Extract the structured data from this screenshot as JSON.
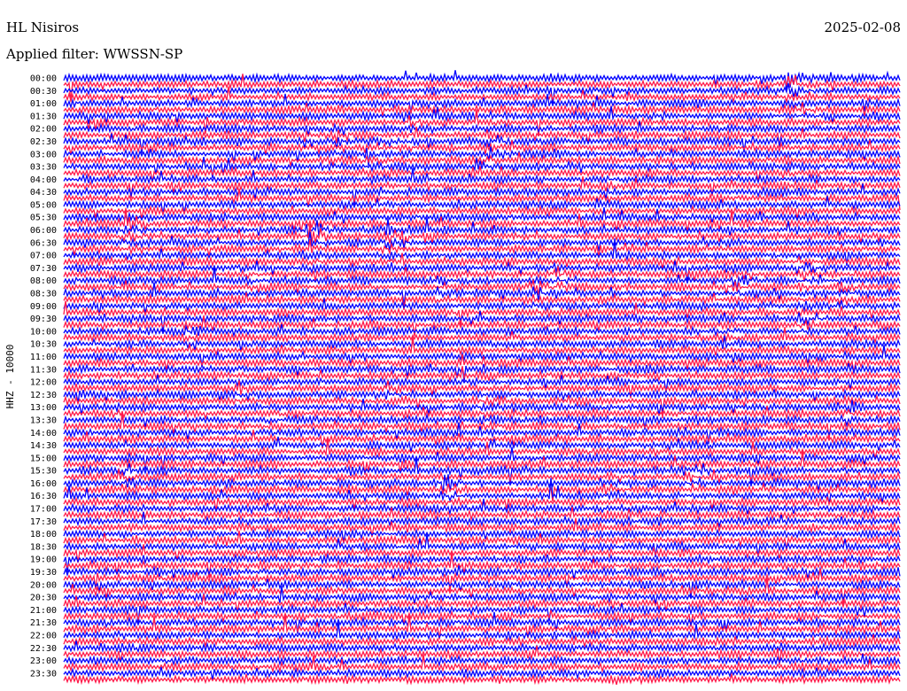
{
  "header": {
    "station": "HL Nisiros",
    "filter": "Applied filter: WWSSN-SP",
    "date": "2025-02-08"
  },
  "chart_data": {
    "type": "line",
    "ylabel": "HHZ - 10000",
    "tick_labels": [
      "00:00",
      "00:30",
      "01:00",
      "01:30",
      "02:00",
      "02:30",
      "03:00",
      "03:30",
      "04:00",
      "04:30",
      "05:00",
      "05:30",
      "06:00",
      "06:30",
      "07:00",
      "07:30",
      "08:00",
      "08:30",
      "09:00",
      "09:30",
      "10:00",
      "10:30",
      "11:00",
      "11:30",
      "12:00",
      "12:30",
      "13:00",
      "13:30",
      "14:00",
      "14:30",
      "15:00",
      "15:30",
      "16:00",
      "16:30",
      "17:00",
      "17:30",
      "18:00",
      "18:30",
      "19:00",
      "19:30",
      "20:00",
      "20:30",
      "21:00",
      "21:30",
      "22:00",
      "22:30",
      "23:00",
      "23:30"
    ],
    "trace_colors": [
      "#0000ff",
      "#ff1a4a"
    ],
    "row_minutes": 15,
    "row_count": 96,
    "x_minutes_per_row": [
      0,
      15
    ],
    "events": [
      {
        "time": "00:00",
        "minute": 13.0,
        "amplitude": 9
      },
      {
        "time": "01:15",
        "minute": 13.2,
        "amplitude": 3
      },
      {
        "time": "01:45",
        "minute": 6.2,
        "amplitude": 3
      },
      {
        "time": "02:15",
        "minute": 4.8,
        "amplitude": 4
      },
      {
        "time": "02:30",
        "minute": 5.6,
        "amplitude": 3
      },
      {
        "time": "02:30",
        "minute": 7.6,
        "amplitude": 5
      },
      {
        "time": "03:00",
        "minute": 5.4,
        "amplitude": 5
      },
      {
        "time": "04:00",
        "minute": 9.7,
        "amplitude": 3
      },
      {
        "time": "05:45",
        "minute": 1.1,
        "amplitude": 9
      },
      {
        "time": "06:00",
        "minute": 4.4,
        "amplitude": 12
      },
      {
        "time": "06:15",
        "minute": 5.8,
        "amplitude": 8
      },
      {
        "time": "07:30",
        "minute": 13.2,
        "amplitude": 5
      },
      {
        "time": "07:45",
        "minute": 3.3,
        "amplitude": 3
      },
      {
        "time": "07:45",
        "minute": 8.8,
        "amplitude": 5
      },
      {
        "time": "07:45",
        "minute": 12.0,
        "amplitude": 8
      },
      {
        "time": "08:00",
        "minute": 6.7,
        "amplitude": 4
      },
      {
        "time": "08:15",
        "minute": 8.4,
        "amplitude": 5
      },
      {
        "time": "08:15",
        "minute": 13.9,
        "amplitude": 4
      },
      {
        "time": "09:30",
        "minute": 13.2,
        "amplitude": 4
      },
      {
        "time": "10:00",
        "minute": 2.2,
        "amplitude": 3
      },
      {
        "time": "10:00",
        "minute": 11.8,
        "amplitude": 3
      },
      {
        "time": "12:15",
        "minute": 3.1,
        "amplitude": 3
      },
      {
        "time": "12:15",
        "minute": 5.8,
        "amplitude": 3
      },
      {
        "time": "12:45",
        "minute": 7.5,
        "amplitude": 3
      },
      {
        "time": "13:00",
        "minute": 14.0,
        "amplitude": 4
      },
      {
        "time": "13:15",
        "minute": 3.6,
        "amplitude": 3
      },
      {
        "time": "15:30",
        "minute": 1.1,
        "amplitude": 6
      },
      {
        "time": "15:30",
        "minute": 11.2,
        "amplitude": 4
      },
      {
        "time": "16:00",
        "minute": 6.8,
        "amplitude": 8
      },
      {
        "time": "16:00",
        "minute": 9.7,
        "amplitude": 3
      }
    ]
  }
}
